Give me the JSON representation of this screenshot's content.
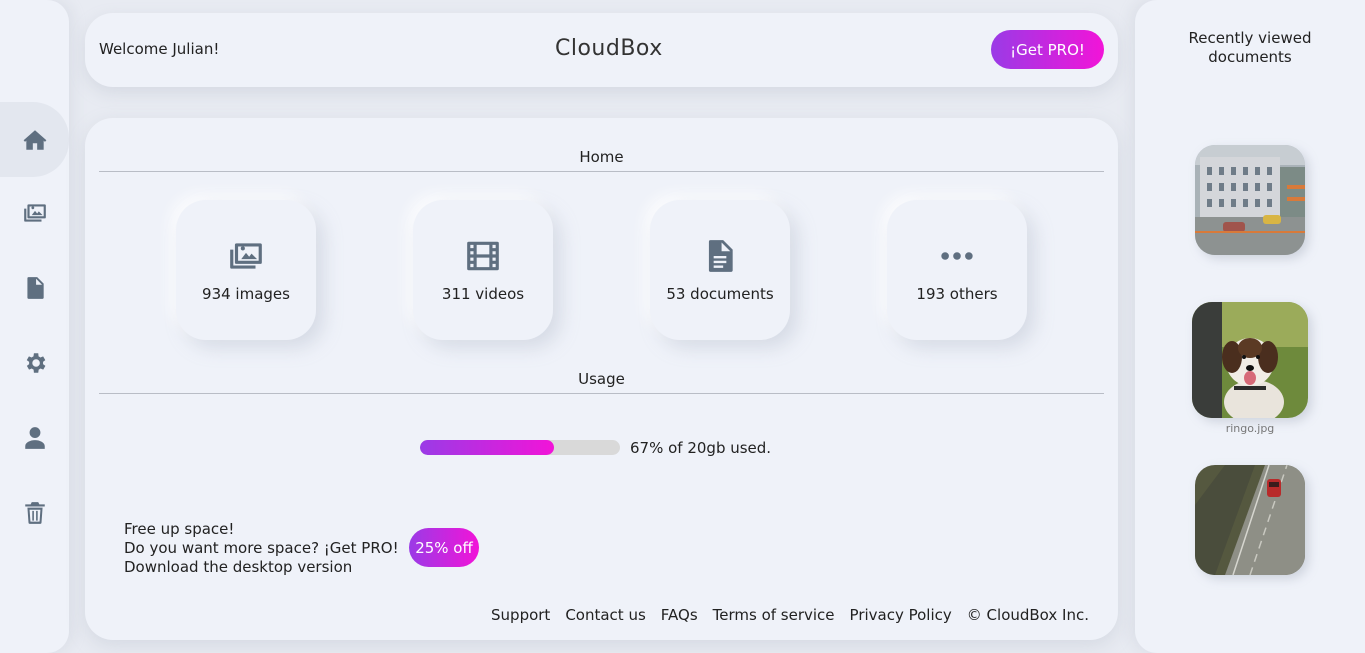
{
  "header": {
    "welcome": "Welcome Julian!",
    "brand": "CloudBox",
    "pro_button": "¡Get PRO!"
  },
  "sidebar": {
    "items": [
      {
        "icon": "home-icon",
        "active": true
      },
      {
        "icon": "images-icon",
        "active": false
      },
      {
        "icon": "document-icon",
        "active": false
      },
      {
        "icon": "gear-icon",
        "active": false
      },
      {
        "icon": "user-icon",
        "active": false
      },
      {
        "icon": "trash-icon",
        "active": false
      }
    ]
  },
  "main": {
    "home_title": "Home",
    "tiles": [
      {
        "icon": "images-icon",
        "label": "934 images"
      },
      {
        "icon": "film-icon",
        "label": "311 videos"
      },
      {
        "icon": "document-icon",
        "label": "53 documents"
      },
      {
        "icon": "ellipsis-icon",
        "label": "193 others"
      }
    ],
    "usage_title": "Usage",
    "usage": {
      "percent": 67,
      "text": "67% of 20gb used."
    },
    "promo": {
      "line1": "Free up space!",
      "line2": "Do you want more space? ¡Get PRO!",
      "line3": "Download the desktop version",
      "badge": "25% off"
    },
    "footer": [
      "Support",
      "Contact us",
      "FAQs",
      "Terms of service",
      "Privacy Policy",
      "© CloudBox Inc."
    ]
  },
  "recent": {
    "title_line1": "Recently viewed",
    "title_line2": "documents",
    "items": [
      {
        "caption": ""
      },
      {
        "caption": "ringo.jpg"
      },
      {
        "caption": ""
      }
    ]
  },
  "colors": {
    "accent_start": "#9a3be6",
    "accent_end": "#f214d8",
    "icon": "#5f6f80",
    "surface": "#eff2f9"
  }
}
